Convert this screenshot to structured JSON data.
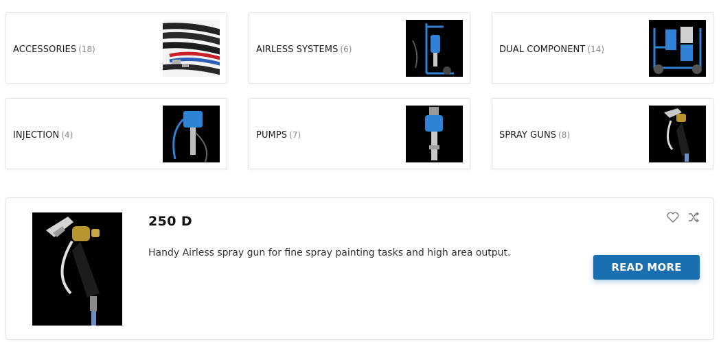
{
  "categories": [
    {
      "name": "ACCESSORIES",
      "count": "(18)",
      "icon": "hoses-thumbnail"
    },
    {
      "name": "AIRLESS SYSTEMS",
      "count": "(6)",
      "icon": "airless-cart-thumbnail"
    },
    {
      "name": "DUAL COMPONENT",
      "count": "(14)",
      "icon": "dual-component-thumbnail"
    },
    {
      "name": "INJECTION",
      "count": "(4)",
      "icon": "injection-pump-thumbnail"
    },
    {
      "name": "PUMPS",
      "count": "(7)",
      "icon": "pump-thumbnail"
    },
    {
      "name": "SPRAY GUNS",
      "count": "(8)",
      "icon": "spray-gun-thumbnail"
    }
  ],
  "product": {
    "title": "250 D",
    "description": "Handy Airless spray gun for fine spray painting tasks and high area output.",
    "button_label": "READ MORE",
    "wishlist_icon": "heart-icon",
    "compare_icon": "shuffle-icon"
  },
  "colors": {
    "accent": "#1a6fb0",
    "count_text": "#888888",
    "thumbnail_background": "#000000"
  }
}
